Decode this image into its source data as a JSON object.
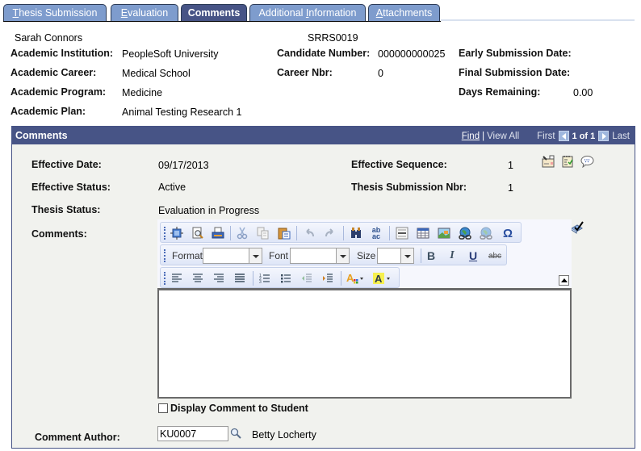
{
  "tabs": [
    {
      "label": "Thesis Submission",
      "accesskey_char": "T",
      "rest": "hesis Submission",
      "active": false
    },
    {
      "label": "Evaluation",
      "accesskey_char": "E",
      "rest": "valuation",
      "active": false
    },
    {
      "label": "Comments",
      "active": true
    },
    {
      "label": "Additional Information",
      "pre": "Additional ",
      "accesskey_char": "I",
      "rest": "nformation",
      "active": false
    },
    {
      "label": "Attachments",
      "accesskey_char": "A",
      "rest": "ttachments",
      "active": false
    }
  ],
  "header": {
    "student_name": "Sarah Connors",
    "student_id": "SRRS0019",
    "fields": {
      "academic_institution": {
        "label": "Academic Institution:",
        "value": "PeopleSoft University"
      },
      "academic_career": {
        "label": "Academic Career:",
        "value": "Medical School"
      },
      "academic_program": {
        "label": "Academic Program:",
        "value": "Medicine"
      },
      "academic_plan": {
        "label": "Academic Plan:",
        "value": "Animal Testing Research 1"
      },
      "candidate_number": {
        "label": "Candidate Number:",
        "value": "000000000025"
      },
      "career_nbr": {
        "label": "Career Nbr:",
        "value": "0"
      },
      "early_submission_date": {
        "label": "Early Submission Date:",
        "value": ""
      },
      "final_submission_date": {
        "label": "Final Submission Date:",
        "value": ""
      },
      "days_remaining": {
        "label": "Days Remaining:",
        "value": "0.00"
      }
    }
  },
  "comments_panel": {
    "title": "Comments",
    "nav": {
      "find": "Find",
      "separator": "|",
      "view_all": "View All",
      "first": "First",
      "count": "1 of 1",
      "last": "Last"
    },
    "fields": {
      "effective_date": {
        "label": "Effective Date:",
        "value": "09/17/2013"
      },
      "effective_status": {
        "label": "Effective Status:",
        "value": "Active"
      },
      "thesis_status": {
        "label": "Thesis Status:",
        "value": "Evaluation in Progress"
      },
      "effective_sequence": {
        "label": "Effective Sequence:",
        "value": "1"
      },
      "thesis_submission_nbr": {
        "label": "Thesis Submission Nbr:",
        "value": "1"
      },
      "comments": {
        "label": "Comments:",
        "value": ""
      }
    },
    "editor": {
      "format_label": "Format",
      "font_label": "Font",
      "size_label": "Size",
      "format_value": "",
      "font_value": "",
      "size_value": "",
      "bold": "B",
      "italic": "I",
      "underline": "U",
      "strike": "abc",
      "special_char": "Ω",
      "find_replace": "ab ac"
    },
    "display_to_student": {
      "label": "Display Comment to Student",
      "checked": false
    },
    "comment_author": {
      "label": "Comment Author:",
      "value": "KU0007",
      "name": "Betty Locherty"
    }
  }
}
